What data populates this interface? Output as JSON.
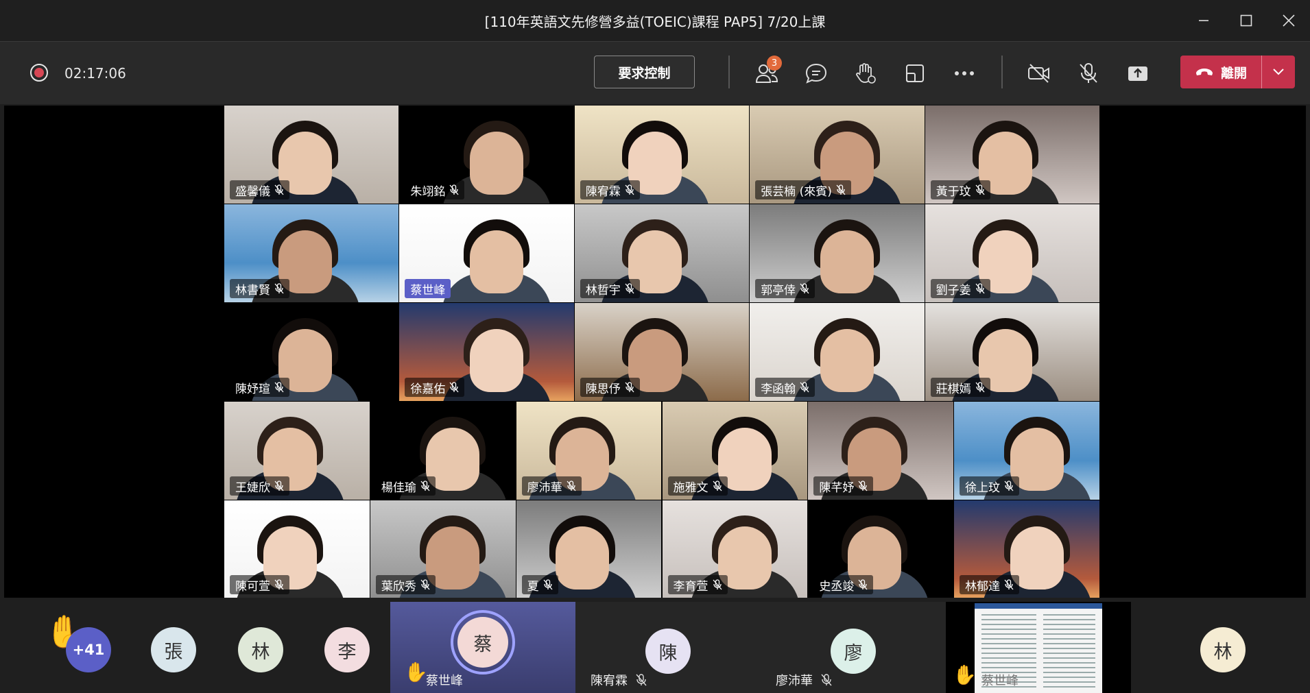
{
  "window": {
    "title": "[110年英語文先修營多益(TOEIC)課程 PAP5] 7/20上課",
    "controls": [
      "minimize-icon",
      "maximize-icon",
      "close-icon"
    ]
  },
  "toolbar": {
    "recording_icon": "record-icon",
    "timer": "02:17:06",
    "request_control_label": "要求控制",
    "participants_badge": "3",
    "icons": [
      "participants-icon",
      "chat-icon",
      "raise-hand-icon",
      "room-view-icon",
      "more-icon",
      "camera-off-icon",
      "mic-off-icon",
      "share-icon"
    ],
    "leave_label": "離開",
    "leave_color": "#c4314b"
  },
  "grid": {
    "rows": [
      [
        {
          "name": "盛馨儀"
        },
        {
          "name": "朱翊銘"
        },
        {
          "name": "陳宥霖"
        },
        {
          "name": "張芸楠 (來賓)"
        },
        {
          "name": "黃于玟"
        }
      ],
      [
        {
          "name": "林書賢"
        },
        {
          "name": "蔡世峰",
          "pinned": true
        },
        {
          "name": "林哲宇"
        },
        {
          "name": "郭亭倖"
        },
        {
          "name": "劉子姜"
        }
      ],
      [
        {
          "name": "陳妤瑄"
        },
        {
          "name": "徐嘉佑"
        },
        {
          "name": "陳思伃"
        },
        {
          "name": "李函翰"
        },
        {
          "name": "莊棋嫣"
        }
      ],
      [
        {
          "name": "王婕欣"
        },
        {
          "name": "楊佳瑜"
        },
        {
          "name": "廖沛華"
        },
        {
          "name": "施雅文"
        },
        {
          "name": "陳芊妤"
        },
        {
          "name": "徐上玟"
        }
      ],
      [
        {
          "name": "陳可萱"
        },
        {
          "name": "葉欣秀"
        },
        {
          "name": "夏"
        },
        {
          "name": "李育萱"
        },
        {
          "name": "史丞竣"
        },
        {
          "name": "林郁達"
        }
      ]
    ]
  },
  "strip": {
    "overflow_count": "+41",
    "avatars": [
      {
        "initial": "張",
        "color": "#d9e6ec"
      },
      {
        "initial": "林",
        "color": "#dfe8d8"
      },
      {
        "initial": "李",
        "color": "#f3dde0"
      }
    ],
    "panels": [
      {
        "initial": "蔡",
        "name": "蔡世峰",
        "color": "#f3d9d6"
      },
      {
        "initial": "陳",
        "name": "陳宥霖",
        "color": "#e6e2f3"
      },
      {
        "initial": "廖",
        "name": "廖沛華",
        "color": "#dcf0e9"
      },
      {
        "name": "蔡世峰"
      },
      {
        "initial": "林",
        "color": "#f5ecd3"
      }
    ]
  }
}
